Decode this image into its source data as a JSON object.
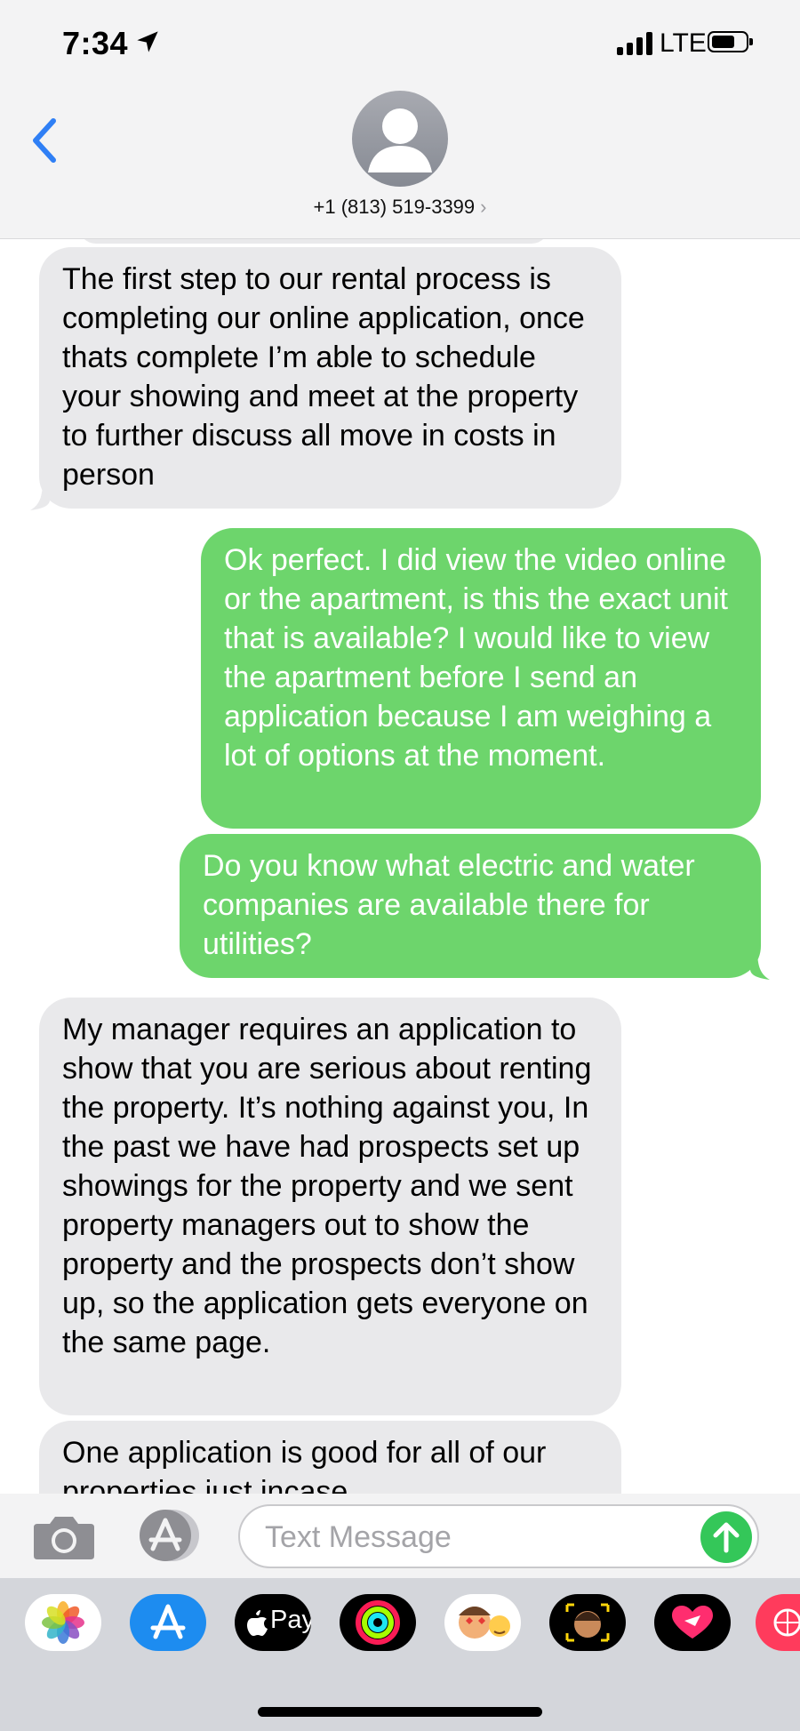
{
  "status_bar": {
    "time": "7:34",
    "carrier": "LTE"
  },
  "header": {
    "contact": "+1 (813) 519-3399",
    "chevron": "›"
  },
  "messages": [
    {
      "direction": "incoming",
      "text": "The first step to our rental process is completing our online application, once thats complete I’m able to schedule your showing and meet at the property to further discuss all move in costs in person"
    },
    {
      "direction": "outgoing",
      "text": "Ok perfect. I did view the video online or the apartment, is this the exact unit that is available? I would like to view the apartment before I send an application because I am weighing a lot of options at the moment."
    },
    {
      "direction": "outgoing",
      "text": "Do you know what electric and water companies are available there for utilities?"
    },
    {
      "direction": "incoming",
      "text": "My manager requires an application to show that you are serious about renting the property. It’s nothing against you, In the past we have had prospects set up showings for the property and we sent property managers out to show the property and the prospects don’t show up, so the application gets everyone on the same page."
    },
    {
      "direction": "incoming",
      "text": "One application is good for all of our properties just incase"
    }
  ],
  "input": {
    "placeholder": "Text Message",
    "value": ""
  },
  "app_drawer": [
    "photos-app",
    "app-store-app",
    "apple-pay-app",
    "activity-app",
    "memoji-stickers-app",
    "memoji-app",
    "heart-sticker-app",
    "digital-touch-app"
  ],
  "apple_pay_label": "Pay",
  "colors": {
    "outgoing": "#6dd56c",
    "incoming": "#e9e9eb",
    "accent": "#2f7ff5",
    "send": "#34c759"
  }
}
